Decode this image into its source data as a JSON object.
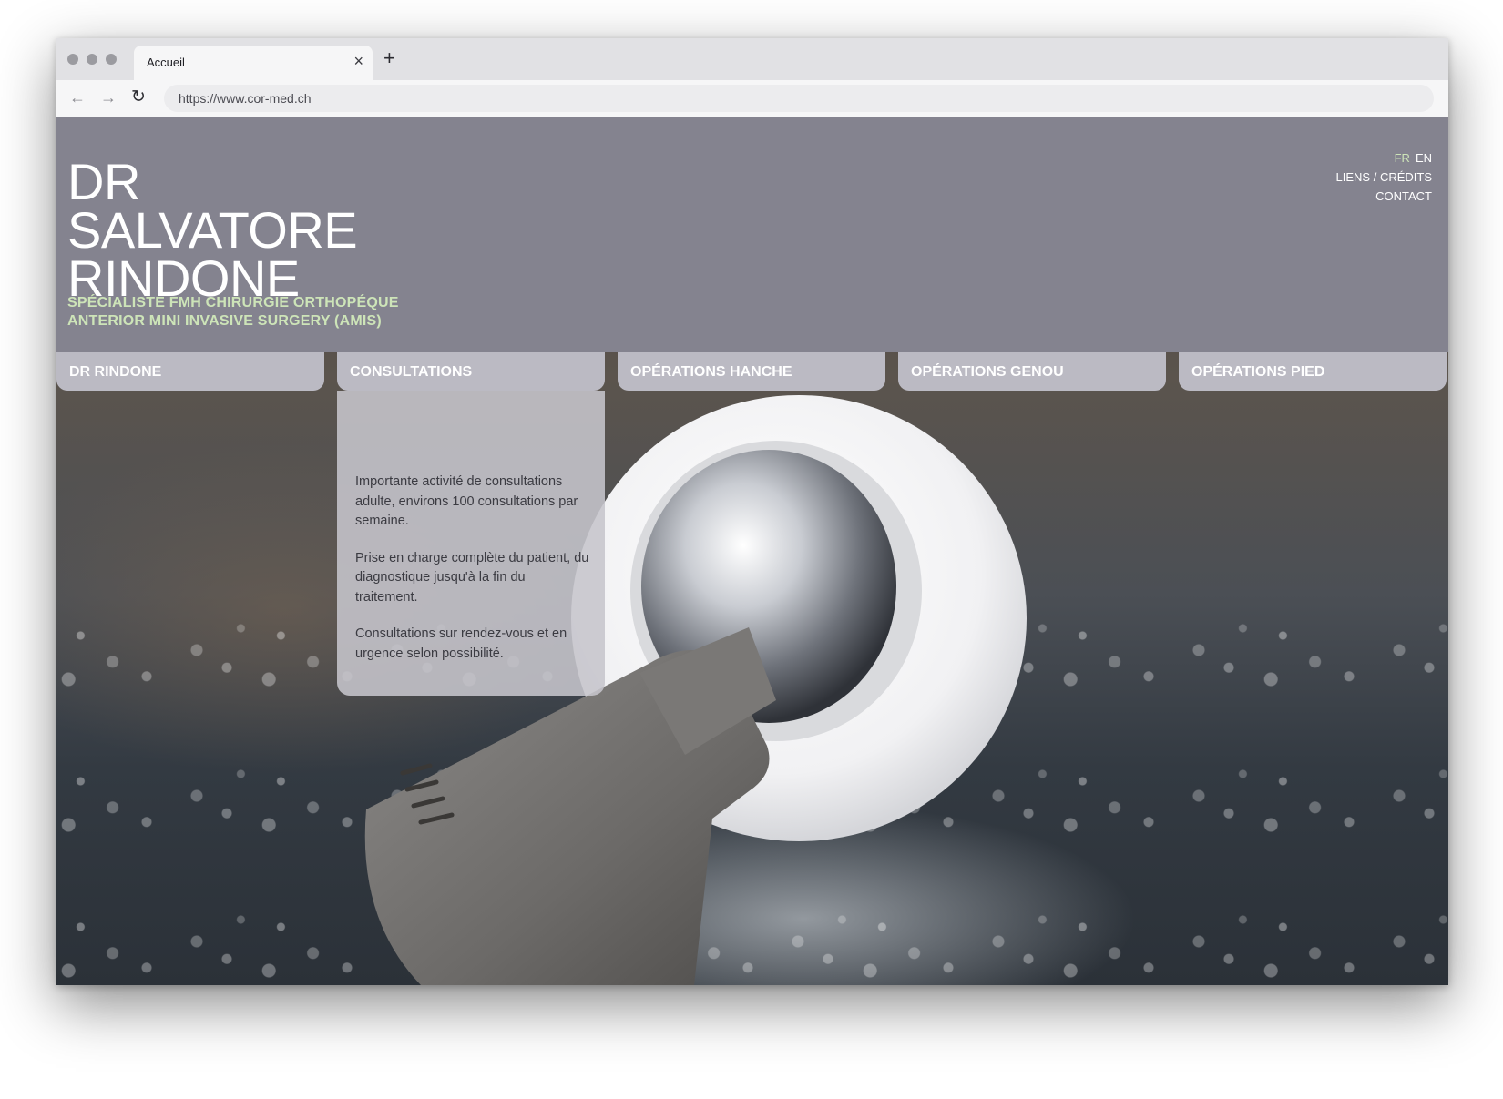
{
  "browser": {
    "tab_title": "Accueil",
    "tab_close": "×",
    "new_tab": "+",
    "back": "←",
    "forward": "→",
    "reload": "↻",
    "url": "https://www.cor-med.ch"
  },
  "header": {
    "name_lines": [
      "DR",
      "SALVATORE",
      "RINDONE"
    ],
    "subtitle_1": "SPÉCIALISTE FMH CHIRURGIE ORTHOPÉQUE",
    "subtitle_2": "ANTERIOR MINI INVASIVE SURGERY (AMIS)",
    "accent_color": "#cde4b8",
    "background_color": "#84838f"
  },
  "top_links": {
    "lang_fr": "FR",
    "lang_en": "EN",
    "links": "LIENS / CRÉDITS",
    "contact": "CONTACT"
  },
  "nav": {
    "tabs": [
      "DR RINDONE",
      "CONSULTATIONS",
      "OPÉRATIONS HANCHE",
      "OPÉRATIONS GENOU",
      "OPÉRATIONS PIED"
    ],
    "active": "CONSULTATIONS"
  },
  "consultations": {
    "paragraphs": [
      "Importante activité de consultations adulte, environs 100 consultations par semaine.",
      "Prise en charge complète du patient, du diagnostique jusqu'à la fin du traitement.",
      "Consultations sur rendez-vous et en urgence selon possibilité."
    ]
  }
}
